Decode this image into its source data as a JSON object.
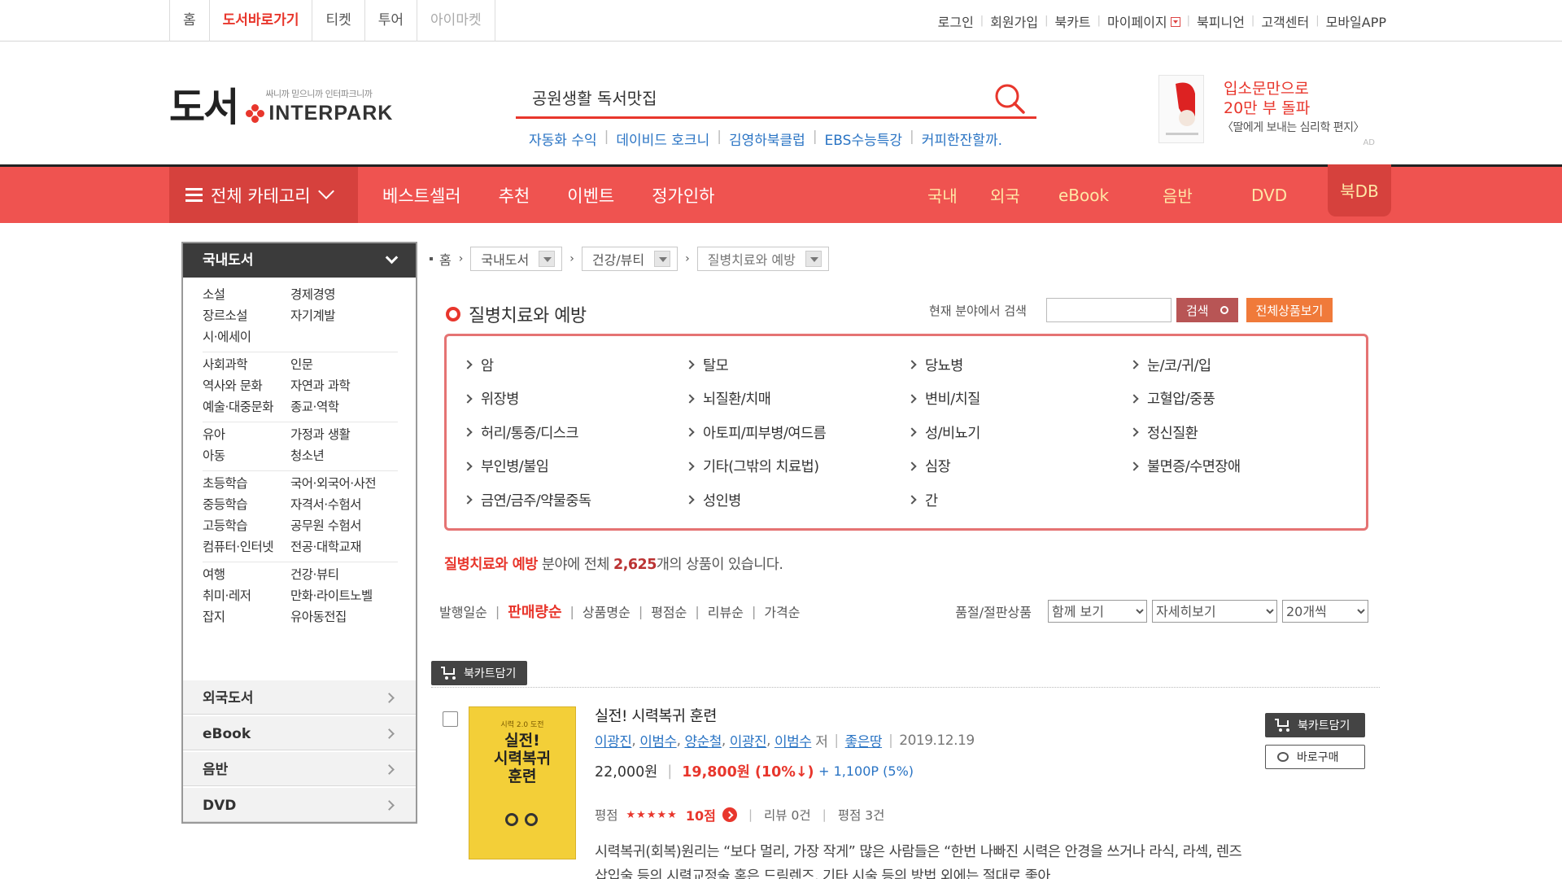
{
  "topbar": {
    "tabs": [
      "홈",
      "도서바로가기",
      "티켓",
      "투어",
      "아이마켓"
    ],
    "util": [
      "로그인",
      "회원가입",
      "북카트",
      "마이페이지",
      "북피니언",
      "고객센터",
      "모바일APP"
    ]
  },
  "header": {
    "logo_text": "도서",
    "slogan": "싸니까 믿으니까 인터파크니까",
    "brand": "INTERPARK",
    "search_value": "공원생활 독서맛집",
    "keywords": [
      "자동화 수익",
      "데이비드 호크니",
      "김영하북클럽",
      "EBS수능특강",
      "커피한잔할까."
    ],
    "ad": {
      "line1": "입소문만으로",
      "line2": "20만 부 돌파",
      "line3": "〈딸에게 보내는 심리학 편지〉",
      "tag": "AD"
    }
  },
  "gnb": {
    "category": "전체 카테고리",
    "main": [
      "베스트셀러",
      "추천",
      "이벤트",
      "정가인하"
    ],
    "sub": [
      "국내",
      "외국",
      "eBook",
      "음반",
      "DVD"
    ],
    "bookdb": "북DB"
  },
  "sidebar": {
    "title": "국내도서",
    "groups": [
      [
        "소설",
        "경제경영",
        "장르소설",
        "자기계발",
        "시·에세이",
        ""
      ],
      [
        "사회과학",
        "인문",
        "역사와 문화",
        "자연과 과학",
        "예술·대중문화",
        "종교·역학"
      ],
      [
        "유아",
        "가정과 생활",
        "아동",
        "청소년"
      ],
      [
        "초등학습",
        "국어·외국어·사전",
        "중등학습",
        "자격서·수험서",
        "고등학습",
        "공무원 수험서",
        "컴퓨터·인터넷",
        "전공·대학교재"
      ],
      [
        "여행",
        "건강·뷰티",
        "취미·레저",
        "만화·라이트노벨",
        "잡지",
        "유아동전집"
      ]
    ],
    "others": [
      "외국도서",
      "eBook",
      "음반",
      "DVD"
    ]
  },
  "breadcrumb": {
    "home": "홈",
    "levels": [
      "국내도서",
      "건강/뷰티",
      "질병치료와 예방"
    ]
  },
  "category": {
    "title": "질병치료와 예방",
    "search_label": "현재 분야에서 검색",
    "search_button": "검색",
    "all_button": "전체상품보기",
    "subcategories": [
      "암",
      "탈모",
      "당뇨병",
      "눈/코/귀/입",
      "위장병",
      "뇌질환/치매",
      "변비/치질",
      "고혈압/중풍",
      "허리/통증/디스크",
      "아토피/피부병/여드름",
      "성/비뇨기",
      "정신질환",
      "부인병/불임",
      "기타(그밖의 치료법)",
      "심장",
      "불면증/수면장애",
      "금연/금주/약물중독",
      "성인병",
      "간"
    ],
    "count_pre": "분야에 전체",
    "count": "2,625",
    "count_post": "개의 상품이 있습니다."
  },
  "sort": {
    "options": [
      "발행일순",
      "판매량순",
      "상품명순",
      "평점순",
      "리뷰순",
      "가격순"
    ],
    "active": "판매량순",
    "filter_label": "품절/절판상품",
    "selects": [
      "함께 보기",
      "자세히보기",
      "20개씩"
    ]
  },
  "cart_all": "북카트담기",
  "item": {
    "cover_top": "시력 2.0 도전",
    "cover_title": "실전!\n시력복귀\n훈련",
    "title": "실전! 시력복귀 훈련",
    "authors": [
      "이광진",
      "이범수",
      "양순철",
      "이광진",
      "이범수"
    ],
    "author_suffix": "저",
    "publisher": "좋은땅",
    "date": "2019.12.19",
    "price": "22,000원",
    "sale": "19,800원 (10%↓)",
    "point": "+ 1,100P (5%)",
    "rating_label": "평점",
    "stars": "★★★★★",
    "rating_score": "10점",
    "reviews": "리뷰 0건",
    "ratings": "평점 3건",
    "description": "시력복귀(회복)원리는 “보다 멀리, 가장 작게” 많은 사람들은 “한번 나빠진 시력은 안경을 쓰거나 라식, 라섹, 렌즈삽입술 등의 시력교정술 혹은 드림렌즈, 기타 시술 등의 방법 외에는 절대로 좋아",
    "cart": "북카트담기",
    "buy": "바로구매"
  }
}
